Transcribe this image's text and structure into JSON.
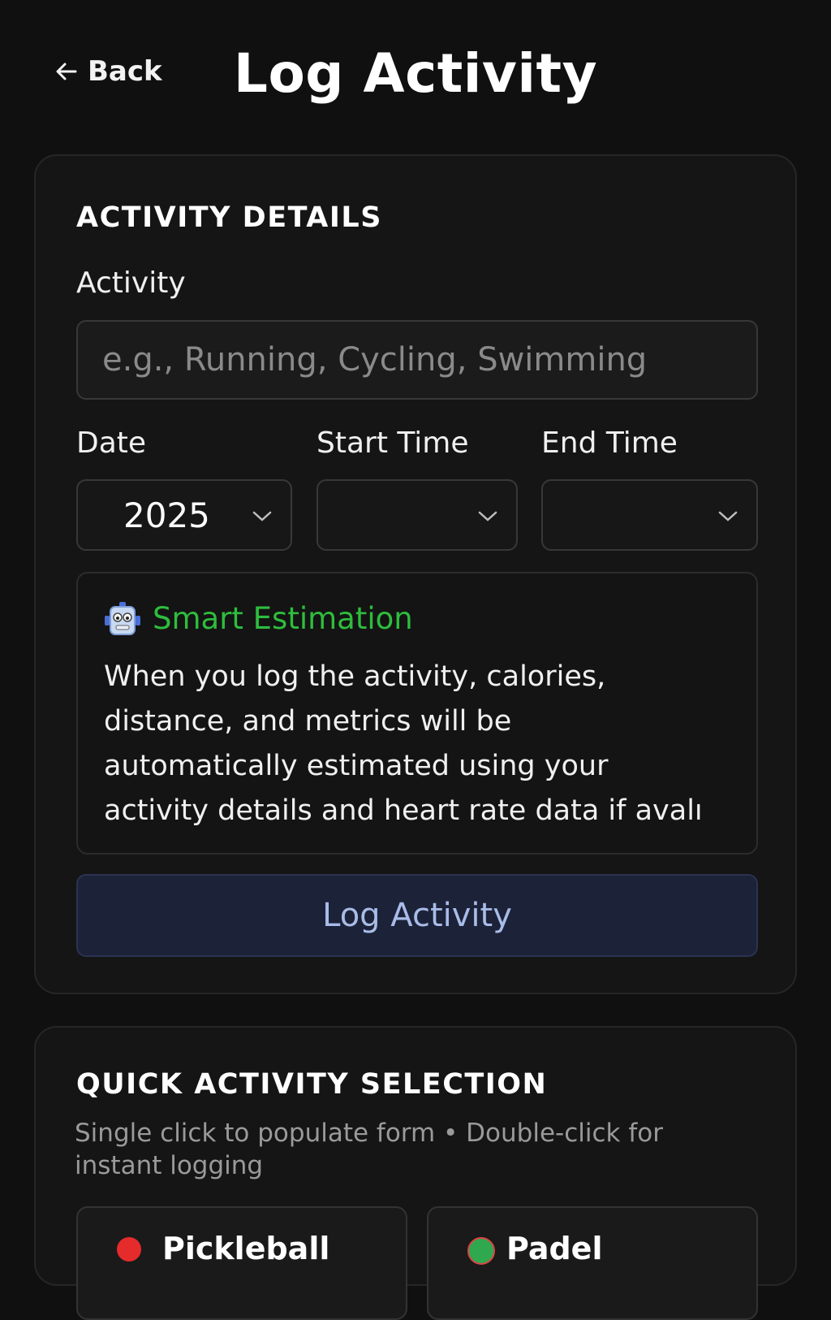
{
  "header": {
    "back_label": "Back",
    "title": "Log Activity"
  },
  "activity_details": {
    "heading": "ACTIVITY DETAILS",
    "activity_label": "Activity",
    "activity_placeholder": "e.g., Running, Cycling, Swimming",
    "activity_value": "",
    "date_label": "Date",
    "date_value": "2025",
    "start_time_label": "Start Time",
    "start_time_value": "",
    "end_time_label": "End Time",
    "end_time_value": ""
  },
  "smart_estimation": {
    "icon": "robot-icon",
    "title": "Smart Estimation",
    "text_lines": [
      "When you log the activity, calories,",
      "distance, and metrics will be",
      "automatically estimated using your",
      "activity details and heart rate data if avalı"
    ],
    "title_color": "#2ebd3d"
  },
  "log_button": {
    "label": "Log Activity"
  },
  "quick_selection": {
    "heading": "QUICK ACTIVITY SELECTION",
    "subtitle": "Single click to populate form • Double-click for instant logging",
    "items": [
      {
        "label": "Pickleball",
        "dot_color": "#e52b2b"
      },
      {
        "label": "Padel",
        "dot_color": "#2fa84f"
      }
    ]
  }
}
